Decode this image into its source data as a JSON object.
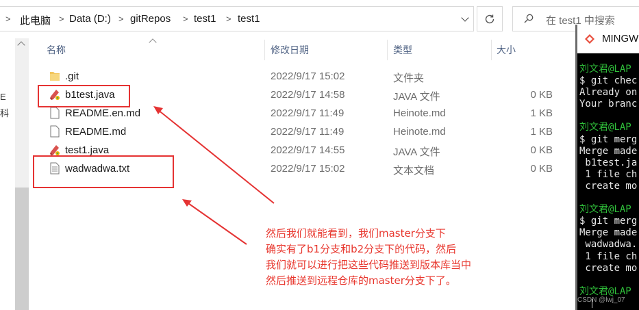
{
  "breadcrumb": {
    "items": [
      "此电脑",
      "Data (D:)",
      "gitRepos",
      "test1",
      "test1"
    ]
  },
  "search": {
    "placeholder": "在 test1 中搜索"
  },
  "columns": {
    "name": "名称",
    "date": "修改日期",
    "type": "类型",
    "size": "大小"
  },
  "files": [
    {
      "name": ".git",
      "date": "2022/9/17 15:02",
      "type": "文件夹",
      "size": "",
      "icon": "folder-icon"
    },
    {
      "name": "b1test.java",
      "date": "2022/9/17 14:58",
      "type": "JAVA 文件",
      "size": "0 KB",
      "icon": "java-file-icon"
    },
    {
      "name": "README.en.md",
      "date": "2022/9/17 11:49",
      "type": "Heinote.md",
      "size": "1 KB",
      "icon": "document-icon"
    },
    {
      "name": "README.md",
      "date": "2022/9/17 11:49",
      "type": "Heinote.md",
      "size": "1 KB",
      "icon": "document-icon"
    },
    {
      "name": "test1.java",
      "date": "2022/9/17 14:55",
      "type": "JAVA 文件",
      "size": "0 KB",
      "icon": "java-file-icon"
    },
    {
      "name": "wadwadwa.txt",
      "date": "2022/9/17 15:02",
      "type": "文本文档",
      "size": "0 KB",
      "icon": "text-file-icon"
    }
  ],
  "left_pane": {
    "glyphs": [
      "E",
      "科"
    ]
  },
  "annotation": {
    "lines": [
      "然后我们就能看到，我们master分支下",
      "确实有了b1分支和b2分支下的代码，然后",
      "我们就可以进行把这些代码推送到版本库当中",
      "然后推送到远程仓库的master分支下了。"
    ],
    "color": "#e8372e"
  },
  "terminal": {
    "title": "MINGW",
    "lines": [
      {
        "text": "刘文君@LAP",
        "kind": "prompt"
      },
      {
        "text": "$ git chec",
        "kind": "cmd"
      },
      {
        "text": "Already on",
        "kind": "out"
      },
      {
        "text": "Your branc",
        "kind": "out"
      },
      {
        "text": "",
        "kind": "out"
      },
      {
        "text": "刘文君@LAP",
        "kind": "prompt"
      },
      {
        "text": "$ git merg",
        "kind": "cmd"
      },
      {
        "text": "Merge made",
        "kind": "out"
      },
      {
        "text": " b1test.ja",
        "kind": "out"
      },
      {
        "text": " 1 file ch",
        "kind": "out"
      },
      {
        "text": " create mo",
        "kind": "out"
      },
      {
        "text": "",
        "kind": "out"
      },
      {
        "text": "刘文君@LAP",
        "kind": "prompt"
      },
      {
        "text": "$ git merg",
        "kind": "cmd"
      },
      {
        "text": "Merge made",
        "kind": "out"
      },
      {
        "text": " wadwadwa.",
        "kind": "out"
      },
      {
        "text": " 1 file ch",
        "kind": "out"
      },
      {
        "text": " create mo",
        "kind": "out"
      },
      {
        "text": "",
        "kind": "out"
      },
      {
        "text": "刘文君@LAP",
        "kind": "prompt"
      }
    ],
    "watermark": "CSDN @lwj_07"
  },
  "colors": {
    "highlight": "#e53333",
    "prompt": "#2fbf3a",
    "header_text": "#4d6082"
  }
}
